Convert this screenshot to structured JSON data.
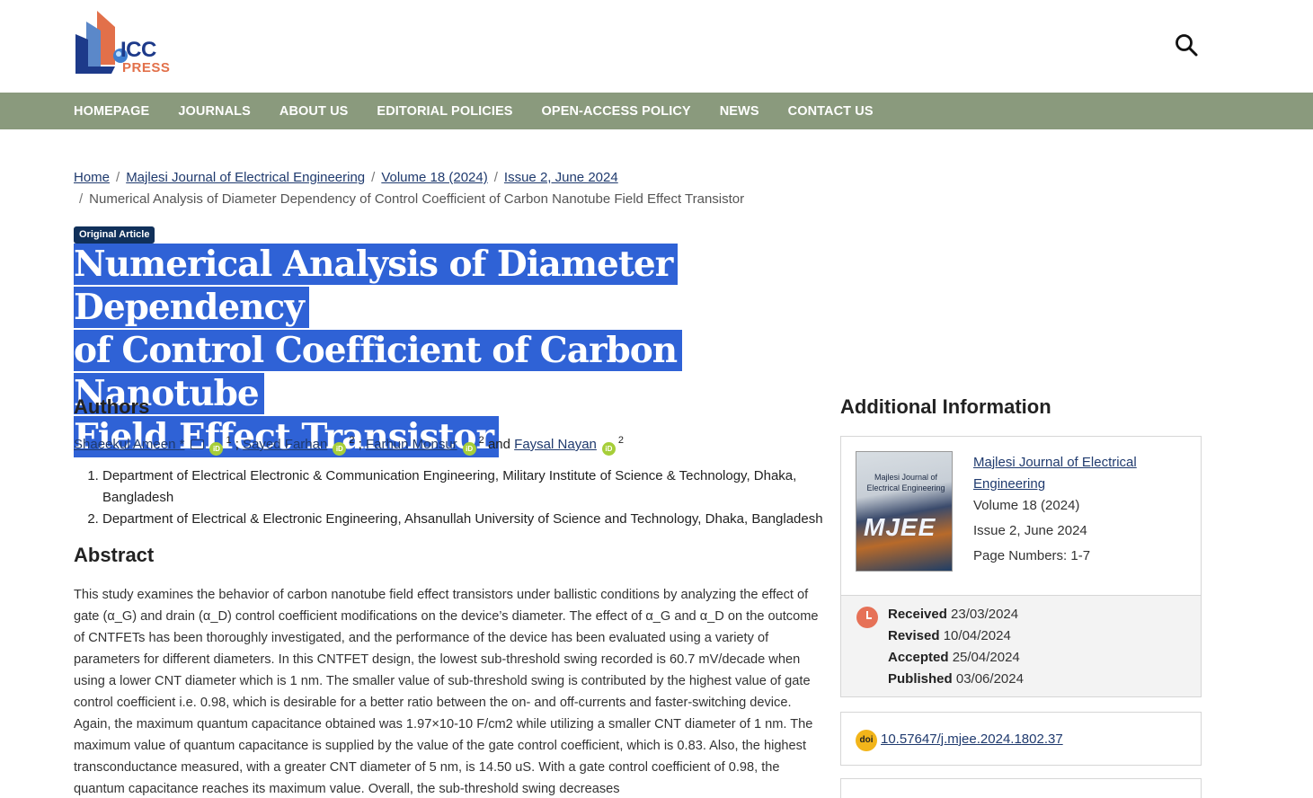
{
  "header": {
    "logo_top": "ICC",
    "logo_bottom": "PRESS"
  },
  "nav": {
    "items": [
      "HOMEPAGE",
      "JOURNALS",
      "ABOUT US",
      "EDITORIAL POLICIES",
      "OPEN-ACCESS POLICY",
      "NEWS",
      "CONTACT US"
    ]
  },
  "breadcrumb": {
    "items": [
      "Home",
      "Majlesi Journal of Electrical Engineering",
      "Volume 18 (2024)",
      "Issue 2, June 2024"
    ],
    "current": "Numerical Analysis of Diameter Dependency of Control Coefficient of Carbon Nanotube Field Effect Transistor",
    "separator": "/"
  },
  "article": {
    "badge": "Original Article",
    "title_lines": [
      "Numerical Analysis of Diameter Dependency",
      "of Control Coefficient of Carbon Nanotube",
      "Field Effect Transistor"
    ]
  },
  "authors_section": {
    "heading": "Authors",
    "authors": [
      {
        "name": "Shaeekul Ameen",
        "corresponding": "*",
        "sup": "1",
        "sep_after": ";"
      },
      {
        "name": "Sayed Farhan",
        "sup": "2",
        "sep_after": ";"
      },
      {
        "name": "Farhun Monsur",
        "sup": "2",
        "sep_after": "and"
      },
      {
        "name": "Faysal Nayan",
        "sup": "2",
        "sep_after": ""
      }
    ],
    "affiliations": [
      "Department of Electrical Electronic & Communication Engineering, Military Institute of Science & Technology, Dhaka, Bangladesh",
      "Department of Electrical & Electronic Engineering, Ahsanullah University of Science and Technology, Dhaka, Bangladesh"
    ]
  },
  "abstract": {
    "heading": "Abstract",
    "text": "This study examines the behavior of carbon nanotube field effect transistors under ballistic conditions by analyzing the effect of gate (α_G) and drain (α_D) control coefficient modifications on the device’s diameter. The effect of α_G and α_D on the outcome of CNTFETs has been thoroughly investigated, and the performance of the device has been evaluated using a variety of parameters for different diameters. In this CNTFET design, the lowest sub-threshold swing recorded is 60.7 mV/decade when using a lower CNT diameter which is 1 nm. The smaller value of sub-threshold swing is contributed by the highest value of gate control coefficient i.e. 0.98, which is desirable for a better ratio between the on- and off-currents and faster-switching device. Again, the maximum quantum capacitance obtained was 1.97×10-10 F/cm2 while utilizing a smaller CNT diameter of 1 nm. The maximum value of quantum capacitance is supplied by the value of the gate control coefficient, which is 0.83. Also, the highest transconductance measured, with a greater CNT diameter of 5 nm, is 14.50 uS. With a gate control coefficient of 0.98, the quantum capacitance reaches its maximum value. Overall, the sub-threshold swing decreases"
  },
  "sidebar": {
    "heading": "Additional Information",
    "cover": {
      "title": "Majlesi Journal of Electrical Engineering",
      "mark": "MJEE"
    },
    "journal_link": "Majlesi Journal of Electrical Engineering",
    "volume": "Volume 18 (2024)",
    "issue": "Issue 2, June 2024",
    "pages": "Page Numbers: 1-7",
    "dates": [
      {
        "label": "Received",
        "value": "23/03/2024"
      },
      {
        "label": "Revised",
        "value": "10/04/2024"
      },
      {
        "label": "Accepted",
        "value": "25/04/2024"
      },
      {
        "label": "Published",
        "value": "03/06/2024"
      }
    ],
    "doi_icon": "doi",
    "doi": "10.57647/j.mjee.2024.1802.37"
  },
  "colors": {
    "nav_bg": "#8a9a7d",
    "title_highlight": "#2f62d6",
    "badge_bg": "#10305a",
    "link": "#1f3a6e",
    "clock": "#e67157",
    "doi_icon": "#f2b51a",
    "orcid": "#a6ce39"
  }
}
